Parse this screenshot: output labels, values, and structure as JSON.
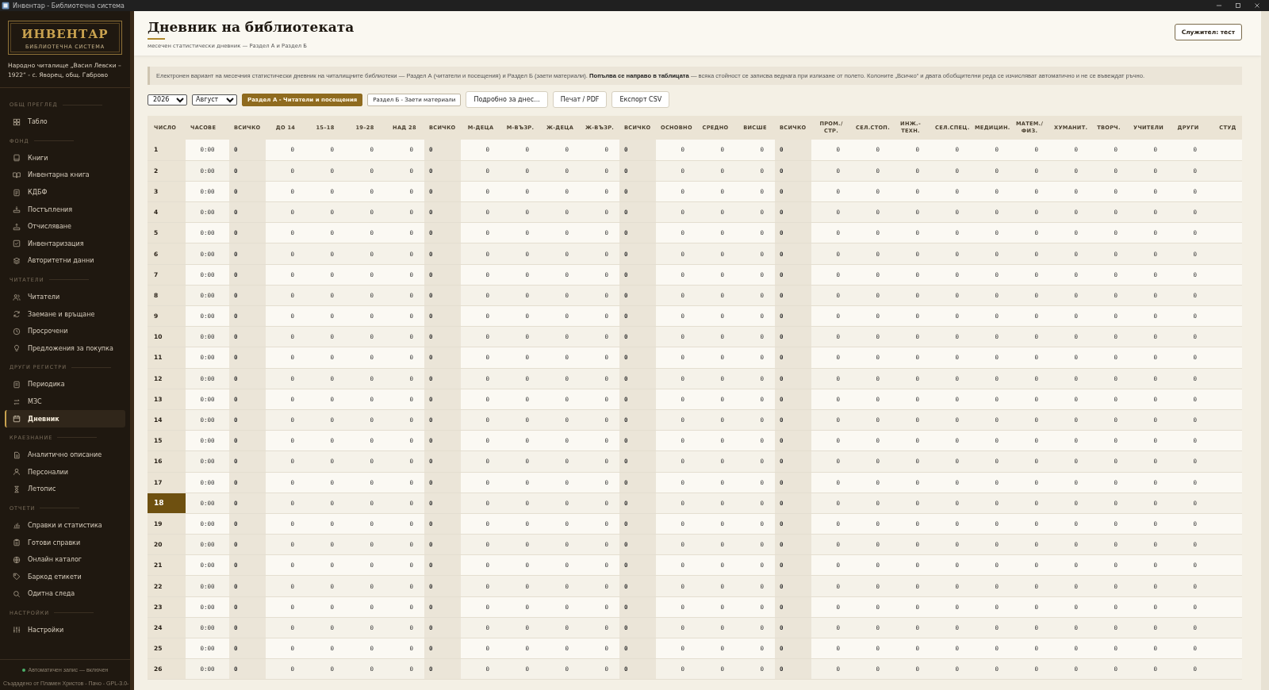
{
  "window": {
    "title": "Инвентар - Библиотечна система"
  },
  "sidebar": {
    "logo": {
      "title": "ИНВЕНТАР",
      "subtitle": "БИБЛИОТЕЧНА СИСТЕМА"
    },
    "organization": "Народно читалище „Васил Левски – 1922“ - с. Яворец, общ. Габрово",
    "sections": [
      {
        "title": "ОБЩ ПРЕГЛЕД",
        "items": [
          {
            "label": "Табло",
            "selected": false
          }
        ]
      },
      {
        "title": "ФОНД",
        "items": [
          {
            "label": "Книги",
            "selected": false
          },
          {
            "label": "Инвентарна книга",
            "selected": false
          },
          {
            "label": "КДБФ",
            "selected": false
          },
          {
            "label": "Постъпления",
            "selected": false
          },
          {
            "label": "Отчисляване",
            "selected": false
          },
          {
            "label": "Инвентаризация",
            "selected": false
          },
          {
            "label": "Авторитетни данни",
            "selected": false
          }
        ]
      },
      {
        "title": "ЧИТАТЕЛИ",
        "items": [
          {
            "label": "Читатели",
            "selected": false
          },
          {
            "label": "Заемане и връщане",
            "selected": false
          },
          {
            "label": "Просрочени",
            "selected": false
          },
          {
            "label": "Предложения за покупка",
            "selected": false
          }
        ]
      },
      {
        "title": "ДРУГИ РЕГИСТРИ",
        "items": [
          {
            "label": "Периодика",
            "selected": false
          },
          {
            "label": "МЗС",
            "selected": false
          },
          {
            "label": "Дневник",
            "selected": true
          }
        ]
      },
      {
        "title": "КРАЕЗНАНИЕ",
        "items": [
          {
            "label": "Аналитично описание",
            "selected": false
          },
          {
            "label": "Персоналии",
            "selected": false
          },
          {
            "label": "Летопис",
            "selected": false
          }
        ]
      },
      {
        "title": "ОТЧЕТИ",
        "items": [
          {
            "label": "Справки и статистика",
            "selected": false
          },
          {
            "label": "Готови справки",
            "selected": false
          },
          {
            "label": "Онлайн каталог",
            "selected": false
          },
          {
            "label": "Баркод етикети",
            "selected": false
          },
          {
            "label": "Одитна следа",
            "selected": false
          }
        ]
      },
      {
        "title": "НАСТРОЙКИ",
        "items": [
          {
            "label": "Настройки",
            "selected": false
          }
        ]
      }
    ],
    "autosave": {
      "label": "Автоматичен запис — включен",
      "on": true
    },
    "credits": "Създадено от Пламен Христов - Пачо - GPL-3.0-"
  },
  "header": {
    "title": "Дневник на библиотеката",
    "subtitle": "месечен статистически дневник — Раздел А и Раздел Б",
    "user_button": "Служител: тест"
  },
  "info": "Електронен вариант на месечния статистически дневник на читалищните библиотеки — Раздел А (читатели и посещения) и Раздел Б (заети материали). **Попълва се направо в таблицата** — всяка стойност се записва веднага при излизане от полето. Колоните „Всичко“ и двата обобщителни реда се изчисляват автоматично и не се въвеждат ръчно.",
  "toolbar": {
    "year": "2026",
    "month": "Август",
    "tabs": [
      {
        "label": "Раздел А - Читатели и посещения",
        "selected": true
      },
      {
        "label": "Раздел Б - Заети материали",
        "selected": false
      }
    ],
    "buttons": [
      "Подробно за днес...",
      "Печат / PDF",
      "Експорт CSV"
    ]
  },
  "table": {
    "columns": [
      {
        "label": "ЧИСЛО",
        "kind": "day"
      },
      {
        "label": "ЧАСОВЕ",
        "kind": "hours"
      },
      {
        "label": "ВСИЧКО",
        "kind": "total"
      },
      {
        "label": "ДО 14",
        "kind": "value"
      },
      {
        "label": "15–18",
        "kind": "value"
      },
      {
        "label": "19–28",
        "kind": "value"
      },
      {
        "label": "НАД 28",
        "kind": "value"
      },
      {
        "label": "ВСИЧКО",
        "kind": "total"
      },
      {
        "label": "М-ДЕЦА",
        "kind": "value"
      },
      {
        "label": "М-ВЪЗР.",
        "kind": "value"
      },
      {
        "label": "Ж-ДЕЦА",
        "kind": "value"
      },
      {
        "label": "Ж-ВЪЗР.",
        "kind": "value"
      },
      {
        "label": "ВСИЧКО",
        "kind": "total"
      },
      {
        "label": "ОСНОВНО",
        "kind": "value"
      },
      {
        "label": "СРЕДНО",
        "kind": "value"
      },
      {
        "label": "ВИСШЕ",
        "kind": "value"
      },
      {
        "label": "ВСИЧКО",
        "kind": "total"
      },
      {
        "label": "ПРОМ./ СТР.",
        "kind": "value"
      },
      {
        "label": "СЕЛ.СТОП.",
        "kind": "value"
      },
      {
        "label": "ИНЖ.- ТЕХН.",
        "kind": "value"
      },
      {
        "label": "СЕЛ.СПЕЦ.",
        "kind": "value"
      },
      {
        "label": "МЕДИЦИН.",
        "kind": "value"
      },
      {
        "label": "МАТЕМ./ ФИЗ.",
        "kind": "value"
      },
      {
        "label": "ХУМАНИТ.",
        "kind": "value"
      },
      {
        "label": "ТВОРЧ.",
        "kind": "value"
      },
      {
        "label": "УЧИТЕЛИ",
        "kind": "value"
      },
      {
        "label": "ДРУГИ",
        "kind": "value"
      },
      {
        "label": "СТУД",
        "kind": "value"
      }
    ],
    "rows": [
      {
        "day": "1",
        "hours": "0:00",
        "selected": false,
        "values": [
          "0",
          "0",
          "0",
          "0",
          "0",
          "0",
          "0",
          "0",
          "0",
          "0",
          "0",
          "0",
          "0",
          "0",
          "0",
          "0",
          "0",
          "0",
          "0",
          "0",
          "0",
          "0",
          "0",
          "0",
          "0"
        ]
      },
      {
        "day": "2",
        "hours": "0:00",
        "selected": false,
        "values": [
          "0",
          "0",
          "0",
          "0",
          "0",
          "0",
          "0",
          "0",
          "0",
          "0",
          "0",
          "0",
          "0",
          "0",
          "0",
          "0",
          "0",
          "0",
          "0",
          "0",
          "0",
          "0",
          "0",
          "0",
          "0"
        ]
      },
      {
        "day": "3",
        "hours": "0:00",
        "selected": false,
        "values": [
          "0",
          "0",
          "0",
          "0",
          "0",
          "0",
          "0",
          "0",
          "0",
          "0",
          "0",
          "0",
          "0",
          "0",
          "0",
          "0",
          "0",
          "0",
          "0",
          "0",
          "0",
          "0",
          "0",
          "0",
          "0"
        ]
      },
      {
        "day": "4",
        "hours": "0:00",
        "selected": false,
        "values": [
          "0",
          "0",
          "0",
          "0",
          "0",
          "0",
          "0",
          "0",
          "0",
          "0",
          "0",
          "0",
          "0",
          "0",
          "0",
          "0",
          "0",
          "0",
          "0",
          "0",
          "0",
          "0",
          "0",
          "0",
          "0"
        ]
      },
      {
        "day": "5",
        "hours": "0:00",
        "selected": false,
        "values": [
          "0",
          "0",
          "0",
          "0",
          "0",
          "0",
          "0",
          "0",
          "0",
          "0",
          "0",
          "0",
          "0",
          "0",
          "0",
          "0",
          "0",
          "0",
          "0",
          "0",
          "0",
          "0",
          "0",
          "0",
          "0"
        ]
      },
      {
        "day": "6",
        "hours": "0:00",
        "selected": false,
        "values": [
          "0",
          "0",
          "0",
          "0",
          "0",
          "0",
          "0",
          "0",
          "0",
          "0",
          "0",
          "0",
          "0",
          "0",
          "0",
          "0",
          "0",
          "0",
          "0",
          "0",
          "0",
          "0",
          "0",
          "0",
          "0"
        ]
      },
      {
        "day": "7",
        "hours": "0:00",
        "selected": false,
        "values": [
          "0",
          "0",
          "0",
          "0",
          "0",
          "0",
          "0",
          "0",
          "0",
          "0",
          "0",
          "0",
          "0",
          "0",
          "0",
          "0",
          "0",
          "0",
          "0",
          "0",
          "0",
          "0",
          "0",
          "0",
          "0"
        ]
      },
      {
        "day": "8",
        "hours": "0:00",
        "selected": false,
        "values": [
          "0",
          "0",
          "0",
          "0",
          "0",
          "0",
          "0",
          "0",
          "0",
          "0",
          "0",
          "0",
          "0",
          "0",
          "0",
          "0",
          "0",
          "0",
          "0",
          "0",
          "0",
          "0",
          "0",
          "0",
          "0"
        ]
      },
      {
        "day": "9",
        "hours": "0:00",
        "selected": false,
        "values": [
          "0",
          "0",
          "0",
          "0",
          "0",
          "0",
          "0",
          "0",
          "0",
          "0",
          "0",
          "0",
          "0",
          "0",
          "0",
          "0",
          "0",
          "0",
          "0",
          "0",
          "0",
          "0",
          "0",
          "0",
          "0"
        ]
      },
      {
        "day": "10",
        "hours": "0:00",
        "selected": false,
        "values": [
          "0",
          "0",
          "0",
          "0",
          "0",
          "0",
          "0",
          "0",
          "0",
          "0",
          "0",
          "0",
          "0",
          "0",
          "0",
          "0",
          "0",
          "0",
          "0",
          "0",
          "0",
          "0",
          "0",
          "0",
          "0"
        ]
      },
      {
        "day": "11",
        "hours": "0:00",
        "selected": false,
        "values": [
          "0",
          "0",
          "0",
          "0",
          "0",
          "0",
          "0",
          "0",
          "0",
          "0",
          "0",
          "0",
          "0",
          "0",
          "0",
          "0",
          "0",
          "0",
          "0",
          "0",
          "0",
          "0",
          "0",
          "0",
          "0"
        ]
      },
      {
        "day": "12",
        "hours": "0:00",
        "selected": false,
        "values": [
          "0",
          "0",
          "0",
          "0",
          "0",
          "0",
          "0",
          "0",
          "0",
          "0",
          "0",
          "0",
          "0",
          "0",
          "0",
          "0",
          "0",
          "0",
          "0",
          "0",
          "0",
          "0",
          "0",
          "0",
          "0"
        ]
      },
      {
        "day": "13",
        "hours": "0:00",
        "selected": false,
        "values": [
          "0",
          "0",
          "0",
          "0",
          "0",
          "0",
          "0",
          "0",
          "0",
          "0",
          "0",
          "0",
          "0",
          "0",
          "0",
          "0",
          "0",
          "0",
          "0",
          "0",
          "0",
          "0",
          "0",
          "0",
          "0"
        ]
      },
      {
        "day": "14",
        "hours": "0:00",
        "selected": false,
        "values": [
          "0",
          "0",
          "0",
          "0",
          "0",
          "0",
          "0",
          "0",
          "0",
          "0",
          "0",
          "0",
          "0",
          "0",
          "0",
          "0",
          "0",
          "0",
          "0",
          "0",
          "0",
          "0",
          "0",
          "0",
          "0"
        ]
      },
      {
        "day": "15",
        "hours": "0:00",
        "selected": false,
        "values": [
          "0",
          "0",
          "0",
          "0",
          "0",
          "0",
          "0",
          "0",
          "0",
          "0",
          "0",
          "0",
          "0",
          "0",
          "0",
          "0",
          "0",
          "0",
          "0",
          "0",
          "0",
          "0",
          "0",
          "0",
          "0"
        ]
      },
      {
        "day": "16",
        "hours": "0:00",
        "selected": false,
        "values": [
          "0",
          "0",
          "0",
          "0",
          "0",
          "0",
          "0",
          "0",
          "0",
          "0",
          "0",
          "0",
          "0",
          "0",
          "0",
          "0",
          "0",
          "0",
          "0",
          "0",
          "0",
          "0",
          "0",
          "0",
          "0"
        ]
      },
      {
        "day": "17",
        "hours": "0:00",
        "selected": false,
        "values": [
          "0",
          "0",
          "0",
          "0",
          "0",
          "0",
          "0",
          "0",
          "0",
          "0",
          "0",
          "0",
          "0",
          "0",
          "0",
          "0",
          "0",
          "0",
          "0",
          "0",
          "0",
          "0",
          "0",
          "0",
          "0"
        ]
      },
      {
        "day": "18",
        "hours": "0:00",
        "selected": true,
        "values": [
          "0",
          "0",
          "0",
          "0",
          "0",
          "0",
          "0",
          "0",
          "0",
          "0",
          "0",
          "0",
          "0",
          "0",
          "0",
          "0",
          "0",
          "0",
          "0",
          "0",
          "0",
          "0",
          "0",
          "0",
          "0"
        ]
      },
      {
        "day": "19",
        "hours": "0:00",
        "selected": false,
        "values": [
          "0",
          "0",
          "0",
          "0",
          "0",
          "0",
          "0",
          "0",
          "0",
          "0",
          "0",
          "0",
          "0",
          "0",
          "0",
          "0",
          "0",
          "0",
          "0",
          "0",
          "0",
          "0",
          "0",
          "0",
          "0"
        ]
      },
      {
        "day": "20",
        "hours": "0:00",
        "selected": false,
        "values": [
          "0",
          "0",
          "0",
          "0",
          "0",
          "0",
          "0",
          "0",
          "0",
          "0",
          "0",
          "0",
          "0",
          "0",
          "0",
          "0",
          "0",
          "0",
          "0",
          "0",
          "0",
          "0",
          "0",
          "0",
          "0"
        ]
      },
      {
        "day": "21",
        "hours": "0:00",
        "selected": false,
        "values": [
          "0",
          "0",
          "0",
          "0",
          "0",
          "0",
          "0",
          "0",
          "0",
          "0",
          "0",
          "0",
          "0",
          "0",
          "0",
          "0",
          "0",
          "0",
          "0",
          "0",
          "0",
          "0",
          "0",
          "0",
          "0"
        ]
      },
      {
        "day": "22",
        "hours": "0:00",
        "selected": false,
        "values": [
          "0",
          "0",
          "0",
          "0",
          "0",
          "0",
          "0",
          "0",
          "0",
          "0",
          "0",
          "0",
          "0",
          "0",
          "0",
          "0",
          "0",
          "0",
          "0",
          "0",
          "0",
          "0",
          "0",
          "0",
          "0"
        ]
      },
      {
        "day": "23",
        "hours": "0:00",
        "selected": false,
        "values": [
          "0",
          "0",
          "0",
          "0",
          "0",
          "0",
          "0",
          "0",
          "0",
          "0",
          "0",
          "0",
          "0",
          "0",
          "0",
          "0",
          "0",
          "0",
          "0",
          "0",
          "0",
          "0",
          "0",
          "0",
          "0"
        ]
      },
      {
        "day": "24",
        "hours": "0:00",
        "selected": false,
        "values": [
          "0",
          "0",
          "0",
          "0",
          "0",
          "0",
          "0",
          "0",
          "0",
          "0",
          "0",
          "0",
          "0",
          "0",
          "0",
          "0",
          "0",
          "0",
          "0",
          "0",
          "0",
          "0",
          "0",
          "0",
          "0"
        ]
      },
      {
        "day": "25",
        "hours": "0:00",
        "selected": false,
        "values": [
          "0",
          "0",
          "0",
          "0",
          "0",
          "0",
          "0",
          "0",
          "0",
          "0",
          "0",
          "0",
          "0",
          "0",
          "0",
          "0",
          "0",
          "0",
          "0",
          "0",
          "0",
          "0",
          "0",
          "0",
          "0"
        ]
      },
      {
        "day": "26",
        "hours": "0:00",
        "selected": false,
        "values": [
          "0",
          "0",
          "0",
          "0",
          "0",
          "0",
          "0",
          "0",
          "0",
          "0",
          "0",
          "0",
          "0",
          "0",
          "0",
          "0",
          "0",
          "0",
          "0",
          "0",
          "0",
          "0",
          "0",
          "0",
          "0"
        ]
      }
    ]
  }
}
